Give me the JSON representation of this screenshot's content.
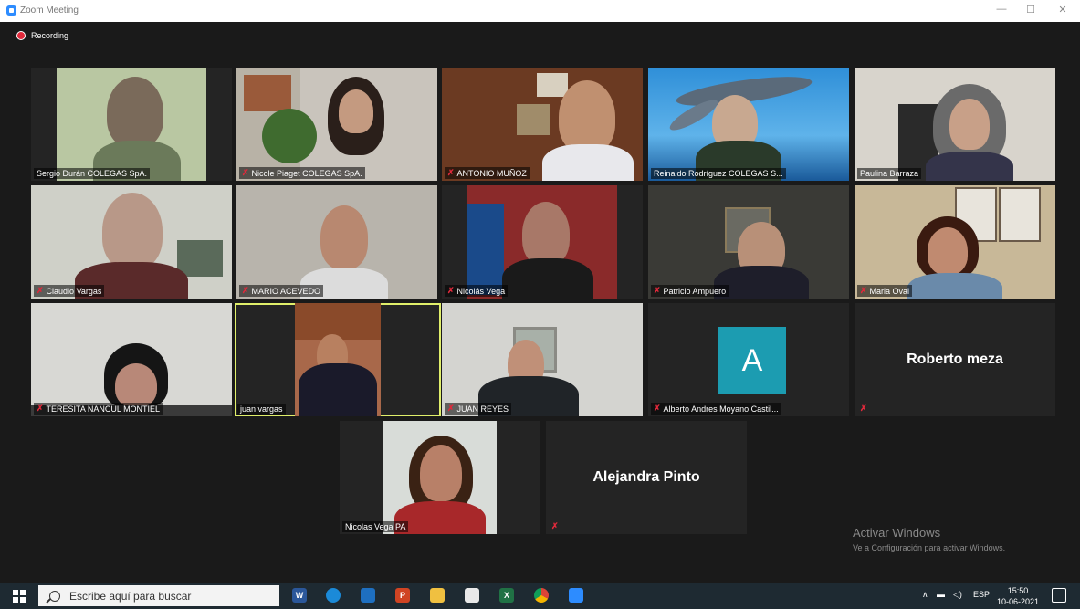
{
  "window": {
    "title": "Zoom Meeting",
    "minimize": "—",
    "maximize": "☐",
    "close": "✕"
  },
  "recording": {
    "label": "Recording"
  },
  "participants": [
    {
      "name": "Sergio Durán COLEGAS SpA.",
      "muted": false
    },
    {
      "name": "Nicole Piaget COLEGAS SpA.",
      "muted": true
    },
    {
      "name": "ANTONIO MUÑOZ",
      "muted": true
    },
    {
      "name": "Reinaldo Rodríguez  COLEGAS S...",
      "muted": false
    },
    {
      "name": "Paulina Barraza",
      "muted": false
    },
    {
      "name": "Claudio Vargas",
      "muted": true
    },
    {
      "name": "MARIO ACEVEDO",
      "muted": true
    },
    {
      "name": "Nicolás Vega",
      "muted": true
    },
    {
      "name": "Patricio Ampuero",
      "muted": true
    },
    {
      "name": "Maria Oval",
      "muted": true
    },
    {
      "name": "TERESITA NANCUL MONTIEL",
      "muted": true
    },
    {
      "name": "juan vargas",
      "muted": false,
      "active_speaker": true
    },
    {
      "name": "JUAN REYES",
      "muted": true
    },
    {
      "name": "Alberto Andres Moyano Castil...",
      "muted": true,
      "avatar_letter": "A"
    },
    {
      "name": "Roberto meza",
      "muted": true,
      "video_off": true
    },
    {
      "name": "Nicolas Vega PA",
      "muted": false
    },
    {
      "name": "Alejandra Pinto",
      "muted": true,
      "video_off": true
    }
  ],
  "watermark": {
    "line1": "Activar Windows",
    "line2": "Ve a Configuración para activar Windows."
  },
  "taskbar": {
    "search_placeholder": "Escribe aquí para buscar",
    "apps": [
      {
        "icon": "word-icon",
        "label": "W"
      },
      {
        "icon": "edge-icon",
        "label": ""
      },
      {
        "icon": "mail-icon",
        "label": ""
      },
      {
        "icon": "powerpoint-icon",
        "label": "P"
      },
      {
        "icon": "file-explorer-icon",
        "label": ""
      },
      {
        "icon": "store-icon",
        "label": ""
      },
      {
        "icon": "excel-icon",
        "label": "X"
      },
      {
        "icon": "chrome-icon",
        "label": ""
      },
      {
        "icon": "zoom-icon",
        "label": ""
      }
    ],
    "language": "ESP",
    "time": "15:50",
    "date": "10-06-2021"
  },
  "colors": {
    "accent_active_speaker": "#e0ef6a",
    "mute": "#e0293b",
    "avatar_bg": "#1c9cb1",
    "zoom_blue": "#2d8cff"
  }
}
